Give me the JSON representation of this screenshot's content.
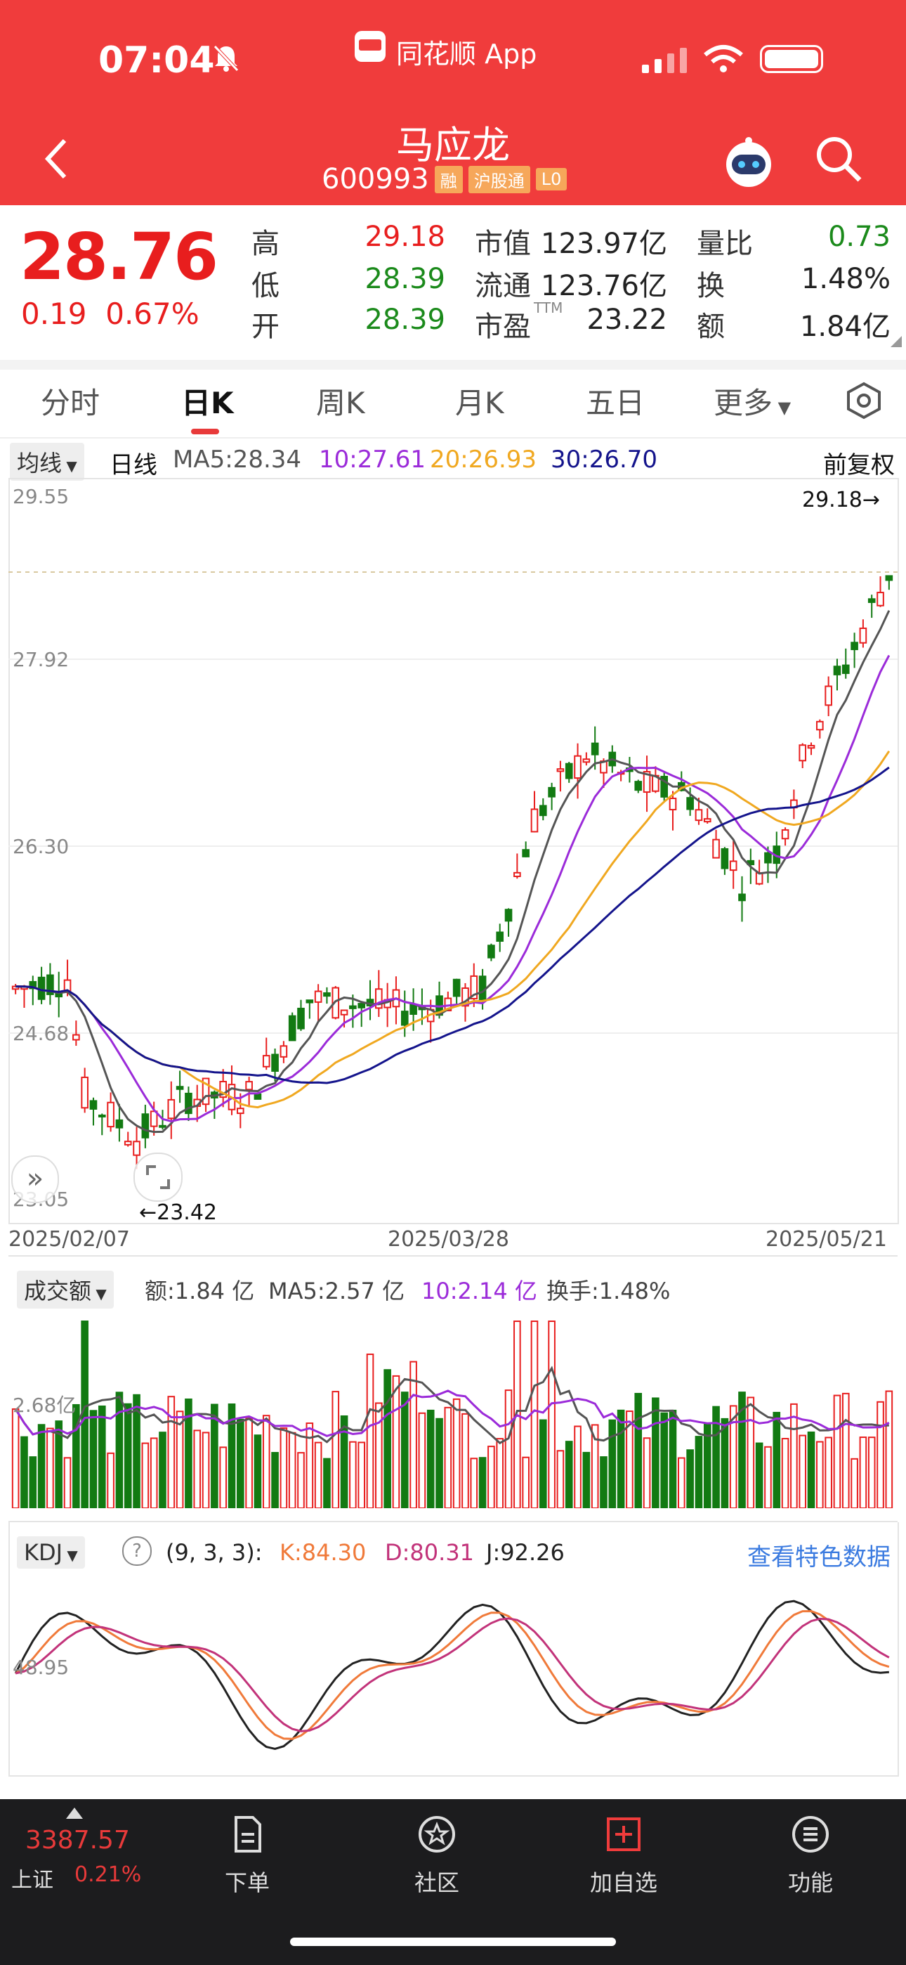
{
  "status_bar": {
    "time": "07:04",
    "app_name": "同花顺 App"
  },
  "header": {
    "stock_name": "马应龙",
    "stock_code": "600993",
    "tags": [
      "融",
      "沪股通",
      "L0"
    ]
  },
  "quote": {
    "price": "28.76",
    "change": "0.19",
    "change_pct": "0.67%",
    "high_label": "高",
    "high": "29.18",
    "low_label": "低",
    "low": "28.39",
    "open_label": "开",
    "open": "28.39",
    "mktcap_label": "市值",
    "mktcap": "123.97亿",
    "float_label": "流通",
    "float": "123.76亿",
    "pe_label": "市盈",
    "pe_sup": "TTM",
    "pe": "23.22",
    "volratio_label": "量比",
    "volratio": "0.73",
    "turnover_label": "换",
    "turnover": "1.48%",
    "amount_label": "额",
    "amount": "1.84亿"
  },
  "tabs": [
    "分时",
    "日K",
    "周K",
    "月K",
    "五日",
    "更多"
  ],
  "active_tab": "日K",
  "kline": {
    "indicator_dropdown": "均线",
    "period": "日线",
    "ma5": "MA5:28.34",
    "ma10": "10:27.61",
    "ma20": "20:26.93",
    "ma30": "30:26.70",
    "adjust": "前复权",
    "y_ticks": [
      "29.55",
      "27.92",
      "26.30",
      "24.68",
      "23.05"
    ],
    "high_marker": "29.18→",
    "low_marker": "←23.42",
    "dates": [
      "2025/02/07",
      "2025/03/28",
      "2025/05/21"
    ],
    "colors": {
      "up": "#e81e1e",
      "down": "#127a12",
      "ma5": "#555555",
      "ma10": "#9b2bd9",
      "ma20": "#f0a820",
      "ma30": "#14148c"
    }
  },
  "volume": {
    "dropdown": "成交额",
    "amount": "额:1.84 亿",
    "ma5": "MA5:2.57 亿",
    "ma10": "10:2.14 亿",
    "turnover": "换手:1.48%",
    "y_tick": "2.68亿"
  },
  "kdj": {
    "dropdown": "KDJ",
    "help": "?",
    "params": "(9, 3, 3):",
    "k": "K:84.30",
    "d": "D:80.31",
    "j": "J:92.26",
    "link": "查看特色数据",
    "y_tick": "48.95",
    "colors": {
      "k": "#f07a3a",
      "d": "#c2337a",
      "j": "#222222"
    }
  },
  "bottom_bar": {
    "index_value": "3387.57",
    "index_name": "上证",
    "index_pct": "0.21%",
    "items": [
      "下单",
      "社区",
      "加自选",
      "功能"
    ]
  }
}
